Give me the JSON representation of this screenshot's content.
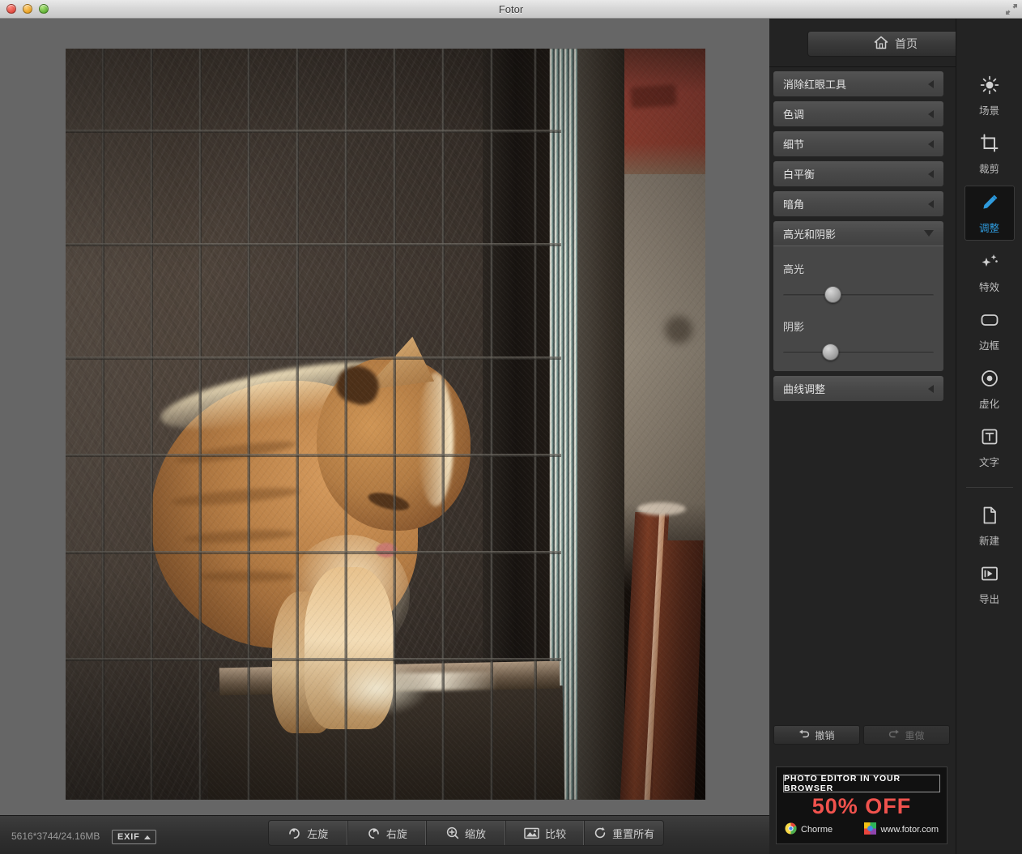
{
  "window": {
    "title": "Fotor",
    "traffic_lights": [
      "close-button",
      "minimize-button",
      "zoom-button"
    ],
    "resize_icon": "resize-corner-icon"
  },
  "canvas": {
    "photo_alt": "ginger cat sitting behind a metal cage grid next to a wall"
  },
  "statusbar": {
    "image_info": "5616*3744/24.16MB",
    "exif_label": "EXIF",
    "tools": [
      {
        "label": "左旋",
        "icon": "rotate-left-icon"
      },
      {
        "label": "右旋",
        "icon": "rotate-right-icon"
      },
      {
        "label": "缩放",
        "icon": "zoom-in-icon"
      },
      {
        "label": "比较",
        "icon": "compare-image-icon"
      },
      {
        "label": "重置所有",
        "icon": "reset-all-icon"
      }
    ]
  },
  "sidebar": {
    "home_label": "首页",
    "home_icon": "home-icon",
    "panels": [
      {
        "label": "消除红眼工具",
        "state": "collapsed",
        "icon": "chevron-left-icon"
      },
      {
        "label": "色调",
        "state": "collapsed",
        "icon": "chevron-left-icon"
      },
      {
        "label": "细节",
        "state": "collapsed",
        "icon": "chevron-left-icon"
      },
      {
        "label": "白平衡",
        "state": "collapsed",
        "icon": "chevron-left-icon"
      },
      {
        "label": "暗角",
        "state": "collapsed",
        "icon": "chevron-left-icon"
      },
      {
        "label": "高光和阴影",
        "state": "expanded",
        "icon": "chevron-down-icon"
      },
      {
        "label": "曲线调整",
        "state": "collapsed",
        "icon": "chevron-left-icon"
      }
    ],
    "sliders": [
      {
        "label": "高光",
        "percent": 33
      },
      {
        "label": "阴影",
        "percent": 31
      }
    ],
    "history": {
      "undo_label": "撤销",
      "undo_icon": "undo-arrow-icon",
      "redo_label": "重做",
      "redo_icon": "redo-arrow-icon",
      "redo_disabled": true
    }
  },
  "ad": {
    "headline": "PHOTO EDITOR IN YOUR BROWSER",
    "offer": "50% OFF",
    "offer_color": "#f0524d",
    "browser_label": "Chorme",
    "browser_icon": "chrome-icon",
    "site_label": "www.fotor.com",
    "site_icon": "fotor-icon"
  },
  "rail": {
    "items": [
      {
        "label": "场景",
        "icon": "sun-icon",
        "active": false
      },
      {
        "label": "裁剪",
        "icon": "crop-icon",
        "active": false
      },
      {
        "label": "调整",
        "icon": "pencil-icon",
        "active": true
      },
      {
        "label": "特效",
        "icon": "sparkles-icon",
        "active": false
      },
      {
        "label": "边框",
        "icon": "rounded-frame-icon",
        "active": false
      },
      {
        "label": "虚化",
        "icon": "tilt-shift-icon",
        "active": false
      },
      {
        "label": "文字",
        "icon": "text-box-icon",
        "active": false
      }
    ],
    "actions": [
      {
        "label": "新建",
        "icon": "new-document-icon"
      },
      {
        "label": "导出",
        "icon": "export-icon"
      }
    ]
  },
  "colors": {
    "accent": "#2f9bdd",
    "panel_bg": "#232323",
    "row_bg": "#484848",
    "canvas_bg": "#666666"
  }
}
